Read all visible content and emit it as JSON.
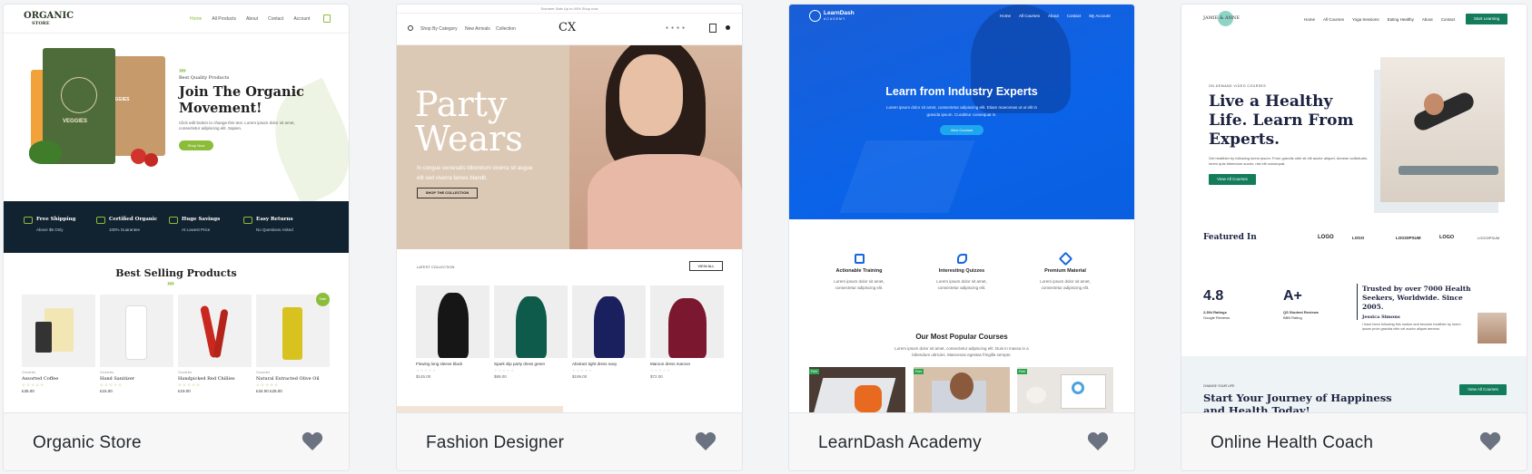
{
  "cards": [
    {
      "title": "Organic Store",
      "preview": {
        "logo_line1": "ORGANIC",
        "logo_line2": "STORE",
        "menu": [
          "Home",
          "All Products",
          "About",
          "Contact",
          "Account"
        ],
        "eyebrow": "Best Quality Products",
        "headline_1": "Join The Organic",
        "headline_2": "Movement!",
        "body": "Click edit button to change this text. Lorem ipsum dolor sit amet, consectetur adipiscing elit. Sapien.",
        "cta": "Shop Now",
        "bag_label": "VEGGIES",
        "bag_label_2": "VEGGIES",
        "features": [
          {
            "title": "Free Shipping",
            "sub": "Above $5 Only"
          },
          {
            "title": "Certified Organic",
            "sub": "100% Guarantee"
          },
          {
            "title": "Huge Savings",
            "sub": "At Lowest Price"
          },
          {
            "title": "Easy Returns",
            "sub": "No Questions Asked"
          }
        ],
        "section_title": "Best Selling Products",
        "sale_badge": "Sale!",
        "products": [
          {
            "cat": "Groceries",
            "name": "Assorted Coffee",
            "price": "£35.00"
          },
          {
            "cat": "Groceries",
            "name": "Hand Sanitizer",
            "price": "£15.00"
          },
          {
            "cat": "Groceries",
            "name": "Handpicked Red Chillies",
            "price": "£19.00"
          },
          {
            "cat": "Groceries",
            "name": "Natural Extracted Olive Oil",
            "price": "£34.00 £25.00"
          }
        ]
      }
    },
    {
      "title": "Fashion Designer",
      "preview": {
        "top_bar": "Summer Sale Up to 40% Shop now",
        "nav_left": [
          "Shop By Category",
          "New Arrivals",
          "Collection"
        ],
        "logo": "CX",
        "headline_1": "Party",
        "headline_2": "Wears",
        "body_1": "In congue venenatis bibendum viverra sit augue",
        "body_2": "elit sed viverra fames blandit.",
        "cta": "SHOP THE COLLECTION",
        "latest": "LATEST COLLECTION",
        "view_all": "VIEW ALL",
        "products": [
          {
            "name": "Flowing long sleeve black",
            "price": "$145.00"
          },
          {
            "name": "Spark slip party dress green",
            "price": "$89.00"
          },
          {
            "name": "Abstract tight dress navy",
            "price": "$199.00"
          },
          {
            "name": "Maroon dress maroon",
            "price": "$72.00"
          }
        ]
      }
    },
    {
      "title": "LearnDash Academy",
      "preview": {
        "logo": "LearnDash",
        "logo_sub": "ACADEMY",
        "menu": [
          "Home",
          "All Courses",
          "About",
          "Contact",
          "My Account"
        ],
        "headline": "Learn from Industry Experts",
        "body_1": "Lorem ipsum dolor sit amet, consectetur adipiscing elit. Etiam maecenas ut ut elit in",
        "body_2": "gravida ipsum. Curabitur consequat in.",
        "cta": "View Courses",
        "features": [
          {
            "title": "Actionable Training",
            "sub1": "Lorem ipsum dolor sit amet,",
            "sub2": "consectetur adipiscing elit."
          },
          {
            "title": "Interesting Quizzes",
            "sub1": "Lorem ipsum dolor sit amet,",
            "sub2": "consectetur adipiscing elit."
          },
          {
            "title": "Premium Material",
            "sub1": "Lorem ipsum dolor sit amet,",
            "sub2": "consectetur adipiscing elit."
          }
        ],
        "section_title": "Our Most Popular Courses",
        "section_body_1": "Lorem ipsum dolor sit amet, consectetur adipiscing elit. Duis in massa in a",
        "section_body_2": "bibendum ultricies. Maecenas egestas fringilla semper.",
        "course_tag": "Free"
      }
    },
    {
      "title": "Online Health Coach",
      "preview": {
        "logo": "JAMIE & ANNE",
        "menu": [
          "Home",
          "All Courses",
          "Yoga Sessions",
          "Eating Healthy",
          "About",
          "Contact"
        ],
        "nav_cta": "Start Learning",
        "eyebrow": "ON-DEMAND VIDEO COURSES",
        "headline_1": "Live a Healthy",
        "headline_2": "Life. Learn From",
        "headline_3": "Experts.",
        "body": "Get healthier by following lorem ipsum. From grandis nibh sit elit auctor aliquet. Aenean sollicitudin, lorem quis bibendum auctor, nisi elit consequat.",
        "cta": "View All Courses",
        "featured": "Featured In",
        "brands": [
          "LOGO",
          "LOGO",
          "LOGOIPSUM",
          "LOGO",
          "LOGOIPSUM"
        ],
        "stat1_big": "4.8",
        "stat1_l1": "2,394 Ratings",
        "stat1_l2": "Google Reviews",
        "stat2_big": "A+",
        "stat2_l1": "QS Student Reviews",
        "stat2_l2": "BBB Rating",
        "trusted_1": "Trusted by over 7000 Health",
        "trusted_2": "Seekers, Worldwide. Since",
        "trusted_3": "2005.",
        "author": "Jessica Simons",
        "quote": "I have been following this routine and become healthier by lorem ipsum proin gravida nibh vel auctor aliquet aenean.",
        "bottom_eyebrow": "CHANGE YOUR LIFE",
        "bottom_title_1": "Start Your Journey of Happiness",
        "bottom_title_2": "and Health Today!",
        "bottom_cta": "View All Courses"
      }
    }
  ]
}
